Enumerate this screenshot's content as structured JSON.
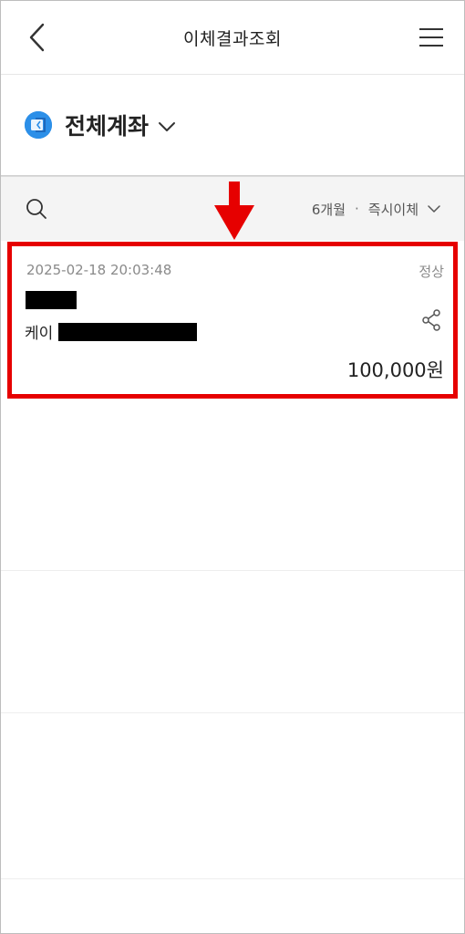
{
  "header": {
    "title": "이체결과조회"
  },
  "account": {
    "name": "전체계좌"
  },
  "filter": {
    "period": "6개월",
    "separator": "·",
    "type": "즉시이체"
  },
  "transactions": [
    {
      "datetime": "2025-02-18 20:03:48",
      "status": "정상",
      "recipient_prefix": "케이",
      "amount": "100,000원"
    }
  ],
  "icons": {
    "back": "chevron-left-icon",
    "menu": "hamburger-menu-icon",
    "bank_logo": "bank-logo-icon",
    "account_dropdown": "chevron-down-icon",
    "search": "search-icon",
    "filter_dropdown": "chevron-down-icon",
    "share": "share-icon",
    "annotation": "red-arrow-icon"
  },
  "colors": {
    "highlight": "#e60000",
    "logo": "#2c8fe8"
  }
}
